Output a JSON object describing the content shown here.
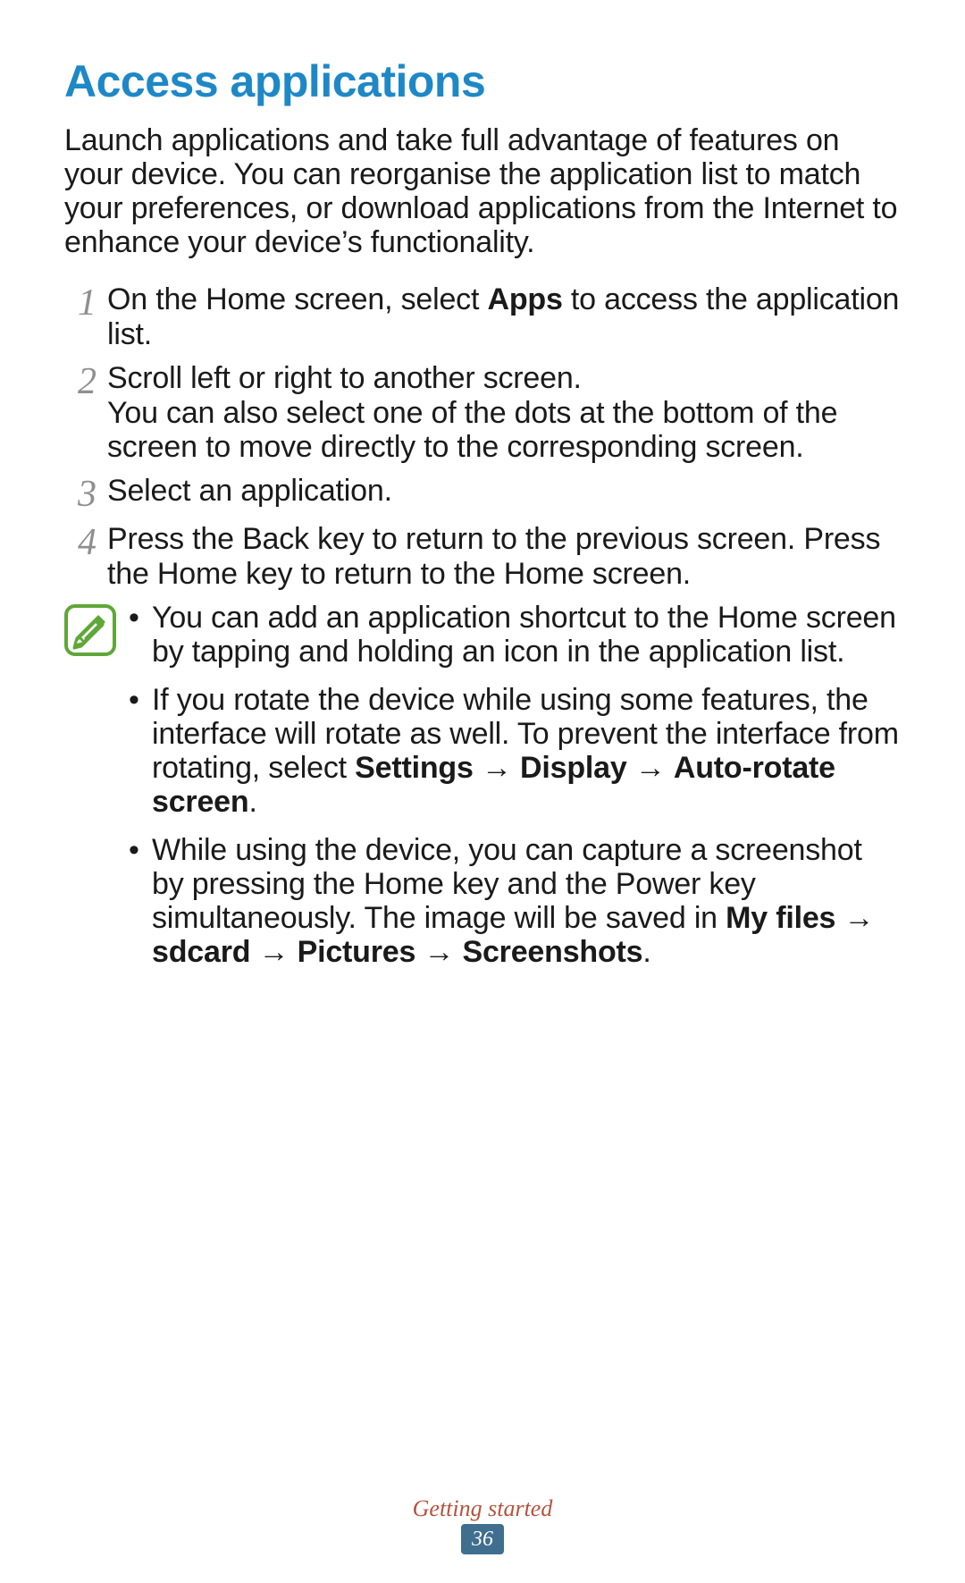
{
  "arrow": "→",
  "heading": "Access applications",
  "intro": "Launch applications and take full advantage of features on your device. You can reorganise the application list to match your preferences, or download applications from the Internet to enhance your device’s functionality.",
  "steps": [
    {
      "num": "1",
      "before": "On the Home screen, select ",
      "bold": "Apps",
      "after": " to access the application list."
    },
    {
      "num": "2",
      "text": "Scroll left or right to another screen.",
      "extra": "You can also select one of the dots at the bottom of the screen to move directly to the corresponding screen."
    },
    {
      "num": "3",
      "text": "Select an application."
    },
    {
      "num": "4",
      "text": "Press the Back key to return to the previous screen. Press the Home key to return to the Home screen."
    }
  ],
  "notes": {
    "b1": "You can add an application shortcut to the Home screen by tapping and holding an icon in the application list.",
    "b2_a": "If you rotate the device while using some features, the interface will rotate as well. To prevent the interface from rotating, select ",
    "b2_settings": "Settings",
    "b2_display": "Display",
    "b2_auto": "Auto-rotate screen",
    "b3_a": "While using the device, you can capture a screenshot by pressing the Home key and the Power key simultaneously. The image will be saved in ",
    "b3_myfiles": "My files",
    "b3_sdcard": "sdcard",
    "b3_pictures": "Pictures",
    "b3_screenshots": "Screenshots"
  },
  "footer": {
    "chapter": "Getting started",
    "page": "36"
  }
}
